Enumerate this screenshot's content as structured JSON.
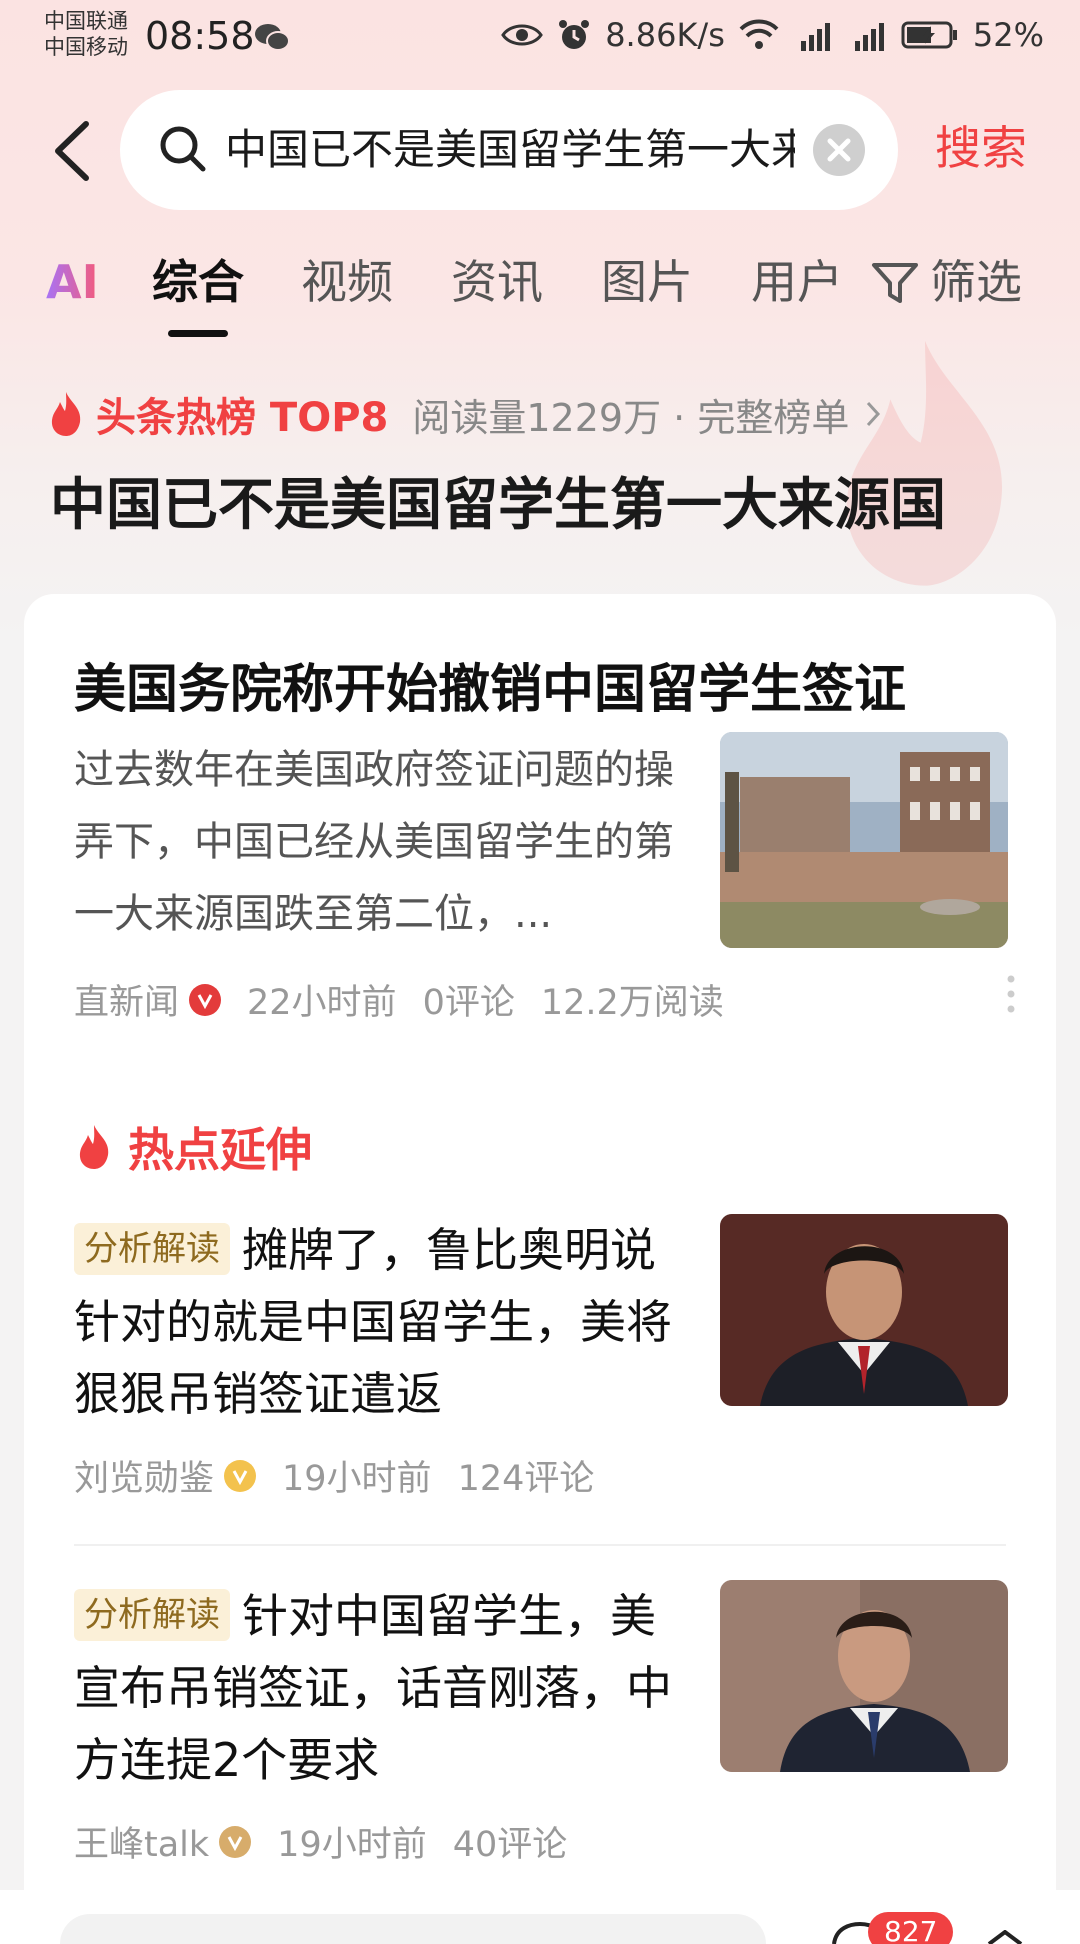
{
  "status_bar": {
    "carrier_1": "中国联通",
    "carrier_2": "中国移动",
    "time": "08:58",
    "net_speed": "8.86K/s",
    "battery": "52%"
  },
  "search": {
    "query": "中国已不是美国留学生第一大来源国",
    "button_label": "搜索"
  },
  "tabs": {
    "ai": "AI",
    "items": [
      "综合",
      "视频",
      "资讯",
      "图片",
      "用户"
    ],
    "active": "综合",
    "filter_label": "筛选"
  },
  "hot_list": {
    "label": "头条热榜 TOP8",
    "meta": "阅读量1229万 · 完整榜单",
    "title": "中国已不是美国留学生第一大来源国"
  },
  "main_article": {
    "title": "美国务院称开始撤销中国留学生签证",
    "summary": "过去数年在美国政府签证问题的操弄下，中国已经从美国留学生的第一大来源国跌至第二位，...",
    "source": "直新闻",
    "time": "22小时前",
    "comments": "0评论",
    "reads": "12.2万阅读"
  },
  "extension": {
    "label": "热点延伸",
    "items": [
      {
        "tag": "分析解读",
        "title": "摊牌了，鲁比奥明说针对的就是中国留学生，美将狠狠吊销签证遣返",
        "source": "刘览勋鉴",
        "time": "19小时前",
        "comments": "124评论"
      },
      {
        "tag": "分析解读",
        "title": "针对中国留学生，美宣布吊销签证，话音刚落，中方连提2个要求",
        "source": "王峰talk",
        "time": "19小时前",
        "comments": "40评论"
      }
    ]
  },
  "bottom_bar": {
    "comment_count": "827"
  },
  "colors": {
    "accent_red": "#f04142",
    "tag_bg": "#fbf0d8",
    "tag_text": "#8e6a1f"
  }
}
